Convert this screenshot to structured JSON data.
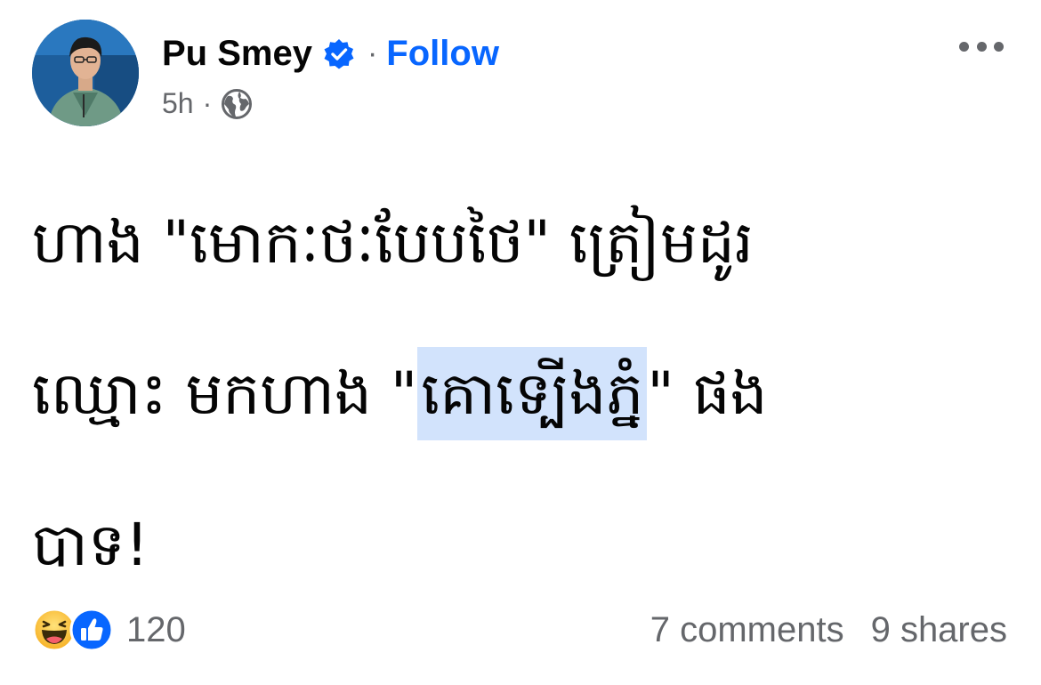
{
  "post": {
    "author": {
      "name": "Pu Smey",
      "verified": true,
      "follow_label": "Follow",
      "separator": "·"
    },
    "meta": {
      "time": "5h",
      "separator": "·",
      "audience_icon": "globe-icon"
    },
    "more_icon": "more-options-icon",
    "text_lines": [
      "ហាង \"មោកៈថៈបែបថៃ\" ត្រៀមដូរ",
      "ឈ្មោះ មកហាង \"",
      "\" ផង",
      "បាទ!"
    ],
    "highlighted_text": "គោទ្បើងភ្នំ",
    "reactions": {
      "icons": [
        "haha-icon",
        "like-icon"
      ],
      "count": "120"
    },
    "comments": "7 comments",
    "shares": "9 shares"
  },
  "colors": {
    "accent": "#0866ff",
    "secondary_text": "#65676b",
    "highlight": "#d2e3fc"
  }
}
